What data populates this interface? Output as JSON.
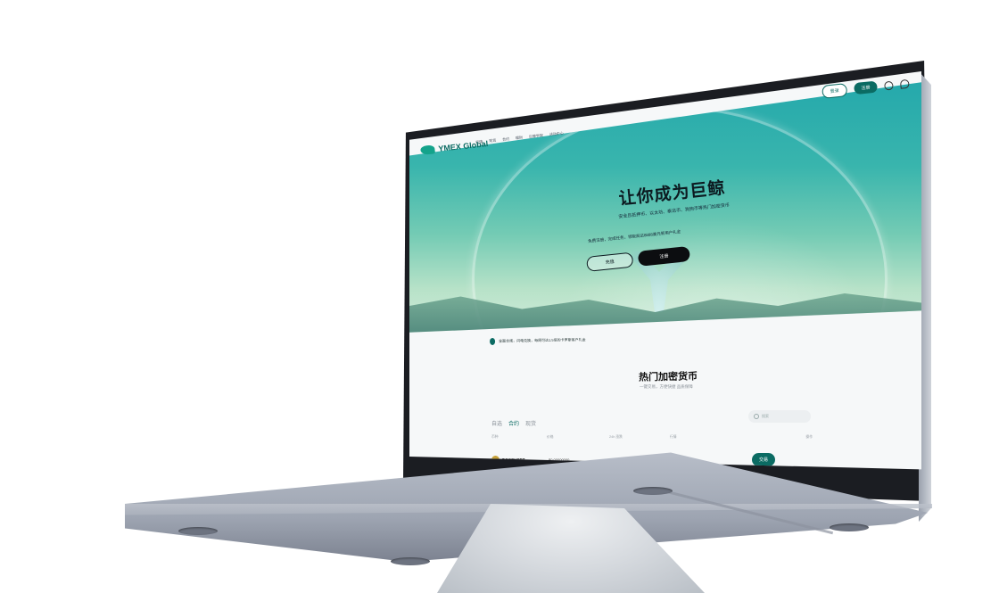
{
  "nav": {
    "brand": "YMEX Global",
    "links": [
      "行情",
      "现货",
      "合约",
      "理财",
      "巨鲸学院",
      "活动中心"
    ],
    "login_label": "登录",
    "register_label": "注册"
  },
  "hero": {
    "title": "让你成为巨鲸",
    "subtitle": "安全且抵押币、以太坊、泰达币、狗狗币等热门加密货币",
    "note": "免费注册，完成任务，领取高达8888美元新用户礼金",
    "login_label": "充值",
    "register_label": "注册"
  },
  "notice": {
    "text": "全面合规，闪电兑换，每周可达1.5倍的卡罗斯客户礼金"
  },
  "markets": {
    "title": "热门加密货币",
    "subtitle": "一键交易，方便快捷 品质保障",
    "tabs": [
      "自选",
      "合约",
      "现货"
    ],
    "active_tab": "合约",
    "search_placeholder": "搜索",
    "columns": [
      "币种",
      "价格",
      "24h 涨跌",
      "行情",
      "操作"
    ],
    "rows": [
      {
        "symbol": "DOGEUSDT",
        "price": "$0.00000000",
        "action": "交易"
      }
    ]
  },
  "colors": {
    "brand": "#0b6b63",
    "hero_top": "#22a7ac",
    "hero_bottom": "#d8efe0",
    "laptop_body": "#9ea5b2"
  }
}
